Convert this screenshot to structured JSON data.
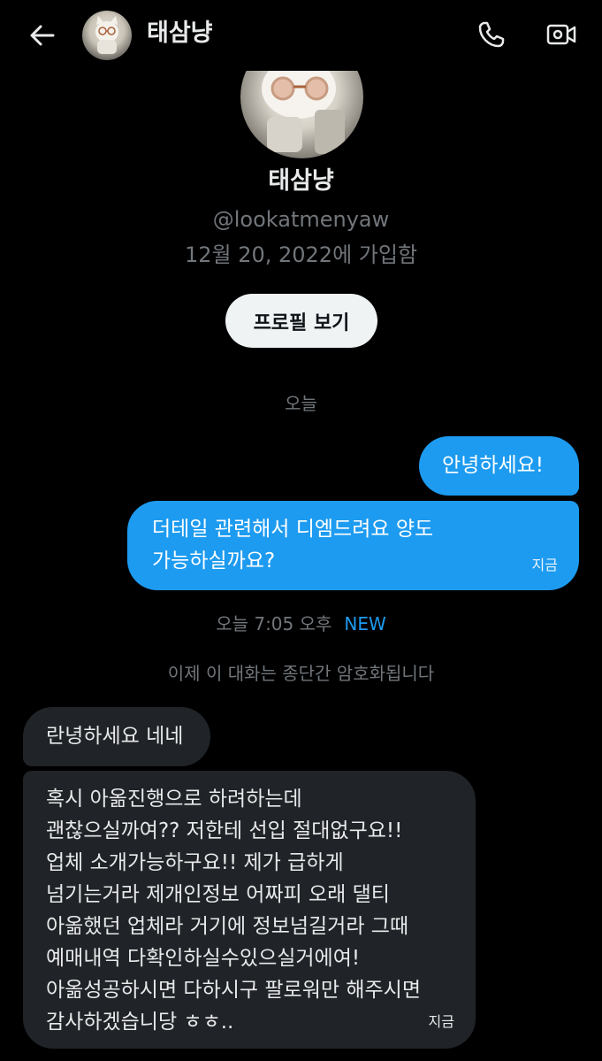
{
  "header": {
    "title": "태삼냥",
    "back_icon": "arrow-left-icon",
    "call_icon": "phone-icon",
    "video_icon": "video-camera-icon"
  },
  "profile": {
    "name": "태삼냥",
    "handle": "@lookatmenyaw",
    "joined": "12월 20, 2022에 가입함",
    "view_button": "프로필 보기"
  },
  "separators": {
    "today": "오늘",
    "time": "오늘 7:05 오후",
    "new_label": "NEW",
    "encryption_notice": "이제 이 대화는 종단간 암호화됩니다"
  },
  "messages": [
    {
      "direction": "sent",
      "lines": [
        "안녕하세요!"
      ],
      "timestamp": ""
    },
    {
      "direction": "sent",
      "lines": [
        "더테일 관련해서 디엠드려요 양도",
        "가능하실까요?"
      ],
      "timestamp": "지금"
    },
    {
      "direction": "received",
      "lines": [
        "란녕하세요 네네"
      ],
      "timestamp": ""
    },
    {
      "direction": "received",
      "lines": [
        "혹시 아옮진행으로 하려하는데",
        "괜찮으실까여?? 저한테 선입 절대없구요!!",
        "업체 소개가능하구요!! 제가 급하게",
        "넘기는거라 제개인정보 어짜피 오래 댈티",
        "아옮했던 업체라 거기에 정보넘길거라 그때",
        "예매내역 다확인하실수있으실거에여!",
        "아옮성공하시면 다하시구 팔로워만 해주시면",
        "감사하겠습니당 ㅎㅎ.."
      ],
      "timestamp": "지금"
    }
  ],
  "colors": {
    "background": "#000000",
    "sent_bubble": "#1d9bf0",
    "received_bubble": "#202327",
    "secondary_text": "#71767b",
    "accent": "#1d9bf0"
  }
}
